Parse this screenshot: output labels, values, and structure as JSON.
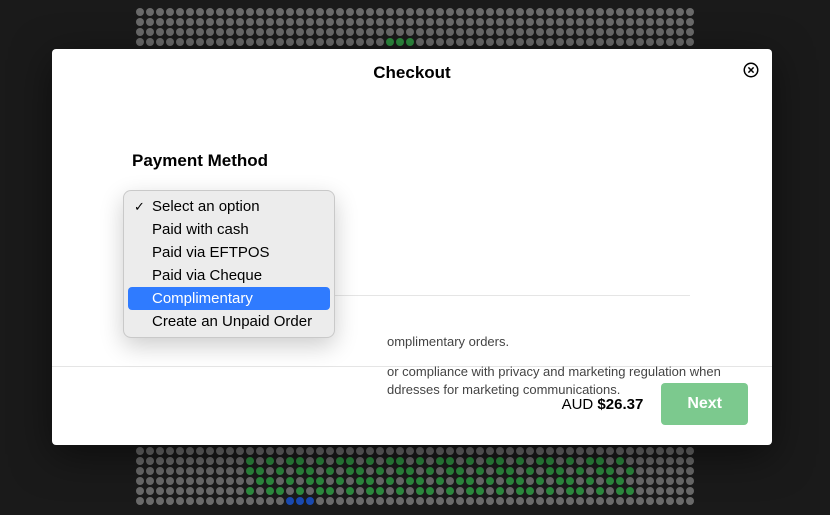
{
  "modal": {
    "title": "Checkout",
    "close_icon": "close-circle"
  },
  "payment": {
    "label": "Payment Method",
    "options": [
      {
        "label": "Select an option",
        "selected": true,
        "highlight": false
      },
      {
        "label": "Paid with cash",
        "selected": false,
        "highlight": false
      },
      {
        "label": "Paid via EFTPOS",
        "selected": false,
        "highlight": false
      },
      {
        "label": "Paid via Cheque",
        "selected": false,
        "highlight": false
      },
      {
        "label": "Complimentary",
        "selected": false,
        "highlight": true
      },
      {
        "label": "Create an Unpaid Order",
        "selected": false,
        "highlight": false
      }
    ]
  },
  "notes": {
    "line1_fragment": "omplimentary orders.",
    "line2_fragment": "or compliance with privacy and marketing regulation when ddresses for marketing communications."
  },
  "footer": {
    "currency": "AUD",
    "amount": "$26.37",
    "next_label": "Next"
  },
  "colors": {
    "highlight": "#2f7bff",
    "next_button": "#7cc98e",
    "seat_available": "#2d8a3e",
    "seat_unavailable": "#6a6a6a"
  }
}
